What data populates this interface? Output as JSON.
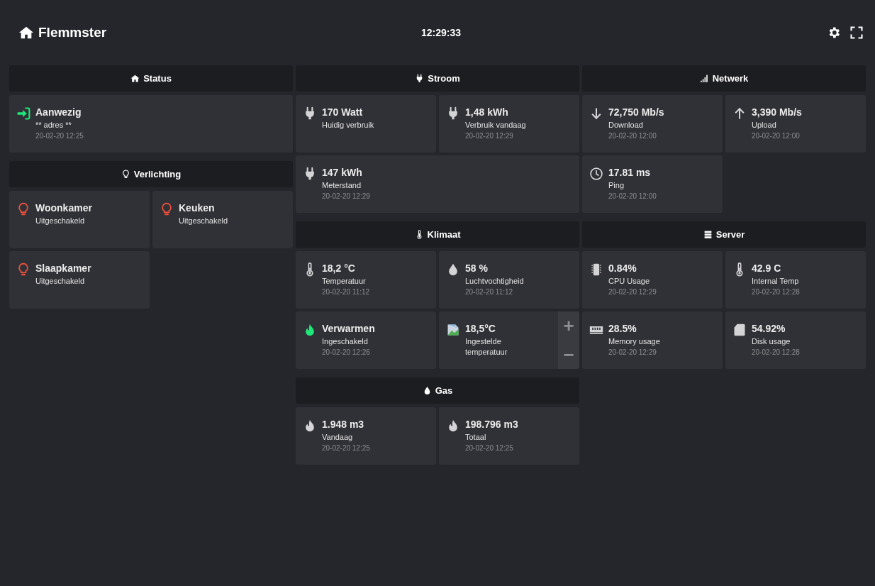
{
  "header": {
    "title": "Flemmster",
    "clock": "12:29:33"
  },
  "columns": [
    {
      "sections": [
        {
          "title": "Status",
          "kind": "home",
          "tiles": [
            {
              "kind": "presence",
              "on": true,
              "wide": true,
              "value": "Aanwezig",
              "label": "** adres **",
              "time": "20-02-20 12:25"
            }
          ]
        },
        {
          "title": "Verlichting",
          "kind": "bulb",
          "tiles": [
            {
              "kind": "light",
              "on": false,
              "value": "Woonkamer",
              "label": "Uitgeschakeld"
            },
            {
              "kind": "light",
              "on": false,
              "value": "Keuken",
              "label": "Uitgeschakeld"
            },
            {
              "kind": "light",
              "on": false,
              "value": "Slaapkamer",
              "label": "Uitgeschakeld"
            }
          ]
        }
      ]
    },
    {
      "sections": [
        {
          "title": "Stroom",
          "kind": "plug",
          "tiles": [
            {
              "kind": "plug",
              "value": "170 Watt",
              "label": "Huidig verbruik"
            },
            {
              "kind": "plug",
              "value": "1,48 kWh",
              "label": "Verbruik vandaag",
              "time": "20-02-20 12:29"
            },
            {
              "kind": "plug",
              "wide": true,
              "value": "147 kWh",
              "label": "Meterstand",
              "time": "20-02-20 12:29"
            }
          ]
        },
        {
          "title": "Klimaat",
          "kind": "thermometer",
          "tiles": [
            {
              "kind": "thermometer",
              "value": "18,2 °C",
              "label": "Temperatuur",
              "time": "20-02-20 11:12"
            },
            {
              "kind": "drop",
              "value": "58 %",
              "label": "Luchtvochtigheid",
              "time": "20-02-20 11:12"
            },
            {
              "kind": "flame",
              "on": true,
              "value": "Verwarmen",
              "label": "Ingeschakeld",
              "time": "20-02-20 12:26"
            },
            {
              "kind": "setpoint",
              "value": "18,5°C",
              "label": "Ingestelde temperatuur",
              "buttons": [
                "+",
                "−"
              ]
            }
          ]
        },
        {
          "title": "Gas",
          "kind": "drop",
          "tiles": [
            {
              "kind": "fire",
              "value": "1.948 m3",
              "label": "Vandaag",
              "time": "20-02-20 12:25"
            },
            {
              "kind": "fire",
              "value": "198.796 m3",
              "label": "Totaal",
              "time": "20-02-20 12:25"
            }
          ]
        }
      ]
    },
    {
      "sections": [
        {
          "title": "Netwerk",
          "kind": "signal",
          "tiles": [
            {
              "kind": "down",
              "value": "72,750 Mb/s",
              "label": "Download",
              "time": "20-02-20 12:00"
            },
            {
              "kind": "up",
              "value": "3,390 Mb/s",
              "label": "Upload",
              "time": "20-02-20 12:00"
            },
            {
              "kind": "clock",
              "value": "17.81 ms",
              "label": "Ping",
              "time": "20-02-20 12:00"
            }
          ]
        },
        {
          "title": "Server",
          "kind": "server",
          "tiles": [
            {
              "kind": "cpu",
              "value": "0.84%",
              "label": "CPU Usage",
              "time": "20-02-20 12:29"
            },
            {
              "kind": "thermometer",
              "value": "42.9 C",
              "label": "Internal Temp",
              "time": "20-02-20 12:28"
            },
            {
              "kind": "memory",
              "value": "28.5%",
              "label": "Memory usage",
              "time": "20-02-20 12:29"
            },
            {
              "kind": "sdcard",
              "value": "54.92%",
              "label": "Disk usage",
              "time": "20-02-20 12:28"
            }
          ]
        }
      ]
    }
  ]
}
